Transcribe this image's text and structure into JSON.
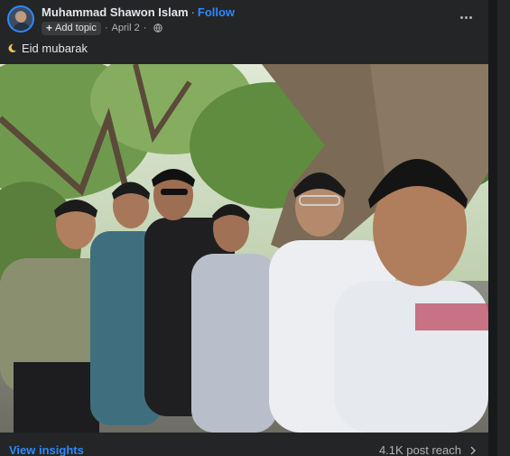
{
  "post": {
    "author_name": "Muhammad Shawon Islam",
    "follow_label": "Follow",
    "add_topic_label": "Add topic",
    "date": "April 2",
    "caption": "Eid mubarak",
    "caption_emoji": "crescent-moon-icon",
    "privacy_icon": "globe-icon",
    "more_icon": "more-options-icon"
  },
  "footer": {
    "insights_label": "View insights",
    "reach_label": "4.1K post reach"
  },
  "colors": {
    "background": "#18191a",
    "card": "#242526",
    "accent": "#2d88ff",
    "secondary_text": "#b0b3b8",
    "primary_text": "#e4e6eb"
  }
}
